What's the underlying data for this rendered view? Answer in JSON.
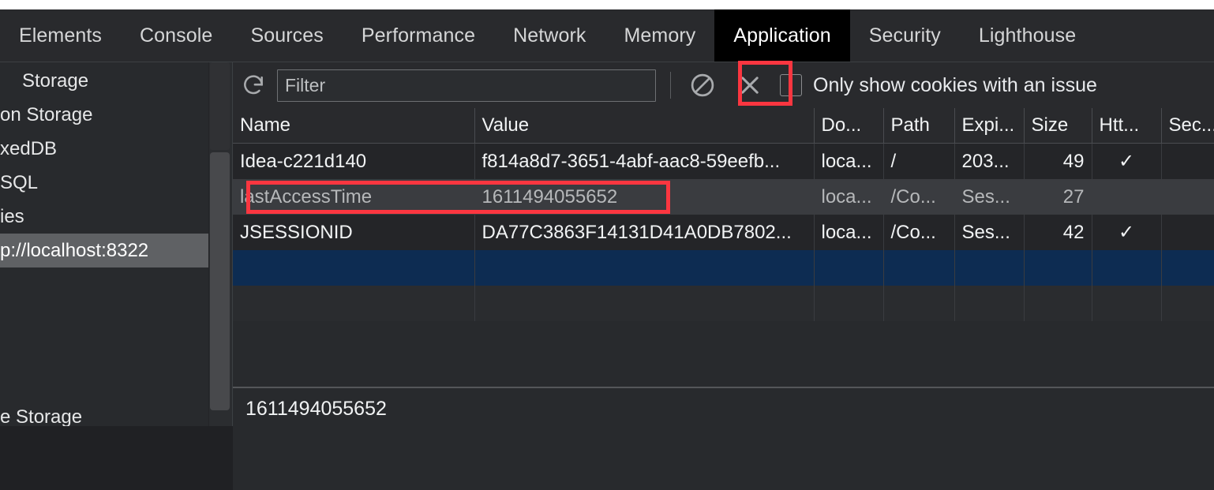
{
  "tabs": [
    {
      "label": "Elements",
      "active": false
    },
    {
      "label": "Console",
      "active": false
    },
    {
      "label": "Sources",
      "active": false
    },
    {
      "label": "Performance",
      "active": false
    },
    {
      "label": "Network",
      "active": false
    },
    {
      "label": "Memory",
      "active": false
    },
    {
      "label": "Application",
      "active": true
    },
    {
      "label": "Security",
      "active": false
    },
    {
      "label": "Lighthouse",
      "active": false
    }
  ],
  "sidebar": {
    "items": [
      {
        "label": "Storage",
        "selected": false,
        "indent": 28
      },
      {
        "label": "on Storage",
        "selected": false,
        "indent": 0
      },
      {
        "label": "xedDB",
        "selected": false,
        "indent": 0
      },
      {
        "label": "SQL",
        "selected": false,
        "indent": 0
      },
      {
        "label": "ies",
        "selected": false,
        "indent": 0
      },
      {
        "label": "p://localhost:8322",
        "selected": true,
        "indent": 0
      },
      {
        "label": "e Storage",
        "selected": false,
        "indent": 0
      }
    ]
  },
  "toolbar": {
    "refresh_icon": "refresh-icon",
    "filter_placeholder": "Filter",
    "filter_value": "",
    "clear_all_icon": "clear-all-cookies-icon",
    "delete_icon": "delete-selected-cookie-icon",
    "checkbox_checked": false,
    "checkbox_label": "Only show cookies with an issue"
  },
  "table": {
    "columns": [
      "Name",
      "Value",
      "Do...",
      "Path",
      "Expi...",
      "Size",
      "Htt...",
      "Sec..."
    ],
    "rows": [
      {
        "style": "row-normal",
        "name": "Idea-c221d140",
        "value": "f814a8d7-3651-4abf-aac8-59eefb...",
        "domain": "loca...",
        "path": "/",
        "expires": "203...",
        "size": "49",
        "httponly": "✓",
        "secure": ""
      },
      {
        "style": "row-alt",
        "name": "lastAccessTime",
        "value": "1611494055652",
        "domain": "loca...",
        "path": "/Co...",
        "expires": "Ses...",
        "size": "27",
        "httponly": "",
        "secure": ""
      },
      {
        "style": "row-normal",
        "name": "JSESSIONID",
        "value": "DA77C3863F14131D41A0DB7802...",
        "domain": "loca...",
        "path": "/Co...",
        "expires": "Ses...",
        "size": "42",
        "httponly": "✓",
        "secure": ""
      },
      {
        "style": "row-selected",
        "name": "",
        "value": "",
        "domain": "",
        "path": "",
        "expires": "",
        "size": "",
        "httponly": "",
        "secure": ""
      },
      {
        "style": "row-empty",
        "name": "",
        "value": "",
        "domain": "",
        "path": "",
        "expires": "",
        "size": "",
        "httponly": "",
        "secure": ""
      }
    ]
  },
  "detail": {
    "value": "1611494055652"
  },
  "colors": {
    "panel_bg": "#282a2d",
    "tab_active_bg": "#000000",
    "row_selected_bg": "#0d2c52",
    "row_hover_bg": "#3a3c40",
    "annotation": "#fb3640",
    "sidebar_selected_bg": "#5f6164"
  },
  "annotations": [
    {
      "name": "delete-cookie-highlight",
      "target": "delete-selected-cookie-icon"
    },
    {
      "name": "last-access-time-row-highlight",
      "target": "table-row-lastAccessTime"
    }
  ]
}
